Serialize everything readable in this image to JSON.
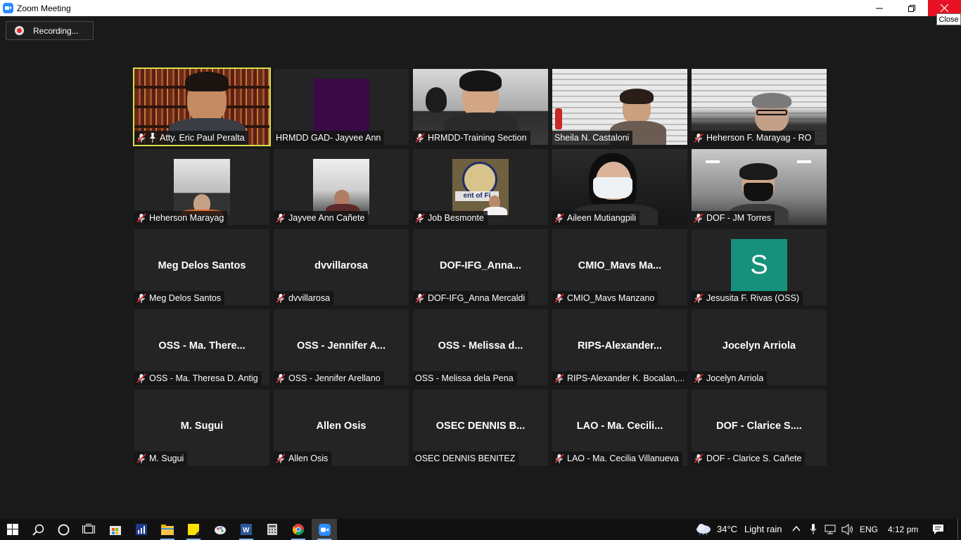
{
  "window": {
    "title": "Zoom Meeting",
    "minimize_icon": "minimize-icon",
    "maximize_icon": "restore-icon",
    "close_icon": "close-icon",
    "close_tooltip": "Close"
  },
  "recording": {
    "label": "Recording..."
  },
  "participants": [
    {
      "name": "Atty. Eric Paul Peralta",
      "video": "books",
      "muted": true,
      "spotlight": true,
      "active_speaker": true
    },
    {
      "name": "HRMDD GAD- Jayvee Ann",
      "video": "purple",
      "muted": false
    },
    {
      "name": "HRMDD-Training Section",
      "video": "office",
      "muted": true
    },
    {
      "name": "Sheila N. Castaloni",
      "video": "blinds",
      "muted": false
    },
    {
      "name": "Heherson F. Marayag - RO",
      "video": "blinds2",
      "muted": true
    },
    {
      "name": "Heherson Marayag",
      "video": "mini-office",
      "muted": true
    },
    {
      "name": "Jayvee Ann Cañete",
      "video": "mini-blinds",
      "muted": true
    },
    {
      "name": "Job Besmonte",
      "video": "mini-seal",
      "muted": true
    },
    {
      "name": "Aileen Mutiangpili",
      "video": "dark",
      "muted": true
    },
    {
      "name": "DOF - JM Torres",
      "video": "ceiling",
      "muted": true
    },
    {
      "name": "Meg Delos Santos",
      "display": "Meg Delos Santos",
      "muted": true
    },
    {
      "name": "dvvillarosa",
      "display": "dvvillarosa",
      "muted": true
    },
    {
      "name": "DOF-IFG_Anna Mercaldi",
      "display": "DOF-IFG_Anna...",
      "muted": true
    },
    {
      "name": "CMIO_Mavs Manzano",
      "display": "CMIO_Mavs  Ma...",
      "muted": true
    },
    {
      "name": "Jesusita F. Rivas (OSS)",
      "avatar": "S",
      "muted": true
    },
    {
      "name": "OSS - Ma. Theresa D. Antig",
      "display": "OSS - Ma. There...",
      "muted": true
    },
    {
      "name": "OSS - Jennifer Arellano",
      "display": "OSS - Jennifer A...",
      "muted": true
    },
    {
      "name": "OSS - Melissa dela Pena",
      "display": "OSS - Melissa d...",
      "muted": false
    },
    {
      "name": "RIPS-Alexander K. Bocalan,...",
      "display": "RIPS-Alexander...",
      "muted": true
    },
    {
      "name": "Jocelyn Arriola",
      "display": "Jocelyn Arriola",
      "muted": true
    },
    {
      "name": "M. Sugui",
      "display": "M. Sugui",
      "muted": true
    },
    {
      "name": "Allen Osis",
      "display": "Allen Osis",
      "muted": true
    },
    {
      "name": "OSEC DENNIS BENITEZ",
      "display": "OSEC DENNIS B...",
      "muted": false
    },
    {
      "name": "LAO - Ma. Cecilia Villanueva",
      "display": "LAO - Ma. Cecili...",
      "muted": true
    },
    {
      "name": "DOF - Clarice S. Cañete",
      "display": "DOF - Clarice S....",
      "muted": true
    }
  ],
  "taskbar": {
    "apps": [
      "windows-start-icon",
      "search-icon",
      "cortana-icon",
      "task-view-icon",
      "store-icon",
      "powerbi-icon",
      "file-explorer-icon",
      "sticky-notes-icon",
      "paint-icon",
      "word-icon",
      "calculator-icon",
      "chrome-icon",
      "zoom-icon"
    ],
    "weather_temp": "34°C",
    "weather_desc": "Light rain",
    "language": "ENG",
    "time": "4:12 pm"
  }
}
